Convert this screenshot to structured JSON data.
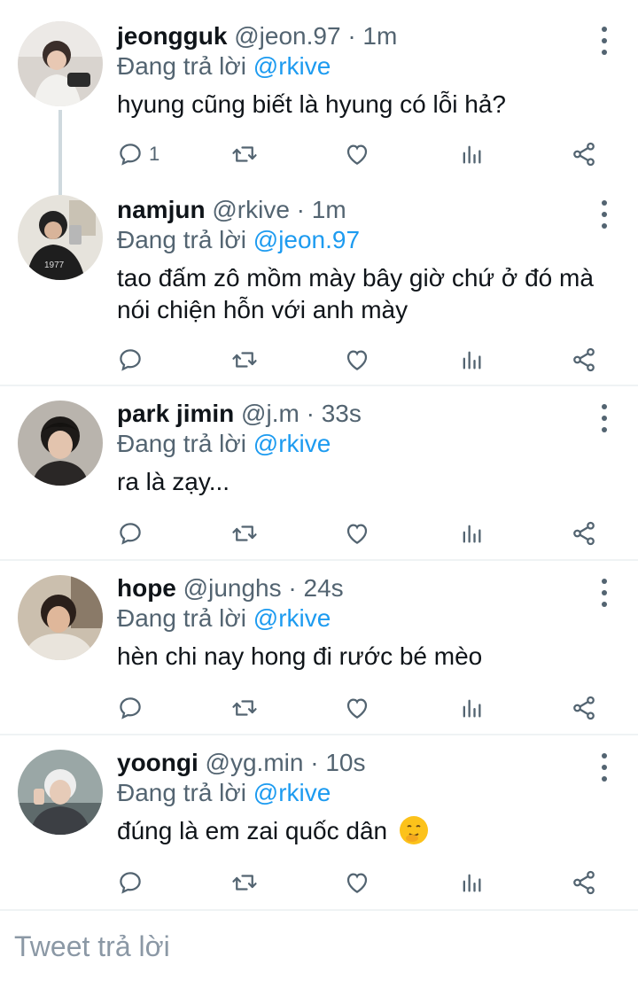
{
  "tweets": [
    {
      "name": "jeongguk",
      "handle": "@jeon.97",
      "separator": "·",
      "time": "1m",
      "reply_prefix": "Đang trả lời",
      "reply_to": "@rkive",
      "text": "hyung cũng biết là hyung có lỗi hả?",
      "reply_count": "1",
      "avatar_icon": "avatar-photo"
    },
    {
      "name": "namjun",
      "handle": "@rkive",
      "separator": "·",
      "time": "1m",
      "reply_prefix": "Đang trả lời",
      "reply_to": "@jeon.97",
      "text": "tao đấm zô mồm mày bây giờ chứ ở đó mà nói chiện hỗn với anh mày",
      "reply_count": "",
      "avatar_icon": "avatar-photo"
    },
    {
      "name": "park jimin",
      "handle": "@j.m",
      "separator": "·",
      "time": "33s",
      "reply_prefix": "Đang trả lời",
      "reply_to": "@rkive",
      "text": "ra là zạy...",
      "reply_count": "",
      "avatar_icon": "avatar-photo"
    },
    {
      "name": "hope",
      "handle": "@junghs",
      "separator": "·",
      "time": "24s",
      "reply_prefix": "Đang trả lời",
      "reply_to": "@rkive",
      "text": "hèn chi nay hong đi rước bé mèo",
      "reply_count": "",
      "avatar_icon": "avatar-photo"
    },
    {
      "name": "yoongi",
      "handle": "@yg.min",
      "separator": "·",
      "time": "10s",
      "reply_prefix": "Đang trả lời",
      "reply_to": "@rkive",
      "text": "đúng là em zai quốc dân",
      "reply_count": "",
      "avatar_icon": "avatar-photo"
    }
  ],
  "compose": {
    "placeholder": "Tweet trả lời"
  },
  "colors": {
    "accent": "#1d9bf0",
    "muted": "#536471",
    "divider": "#eff3f4"
  }
}
